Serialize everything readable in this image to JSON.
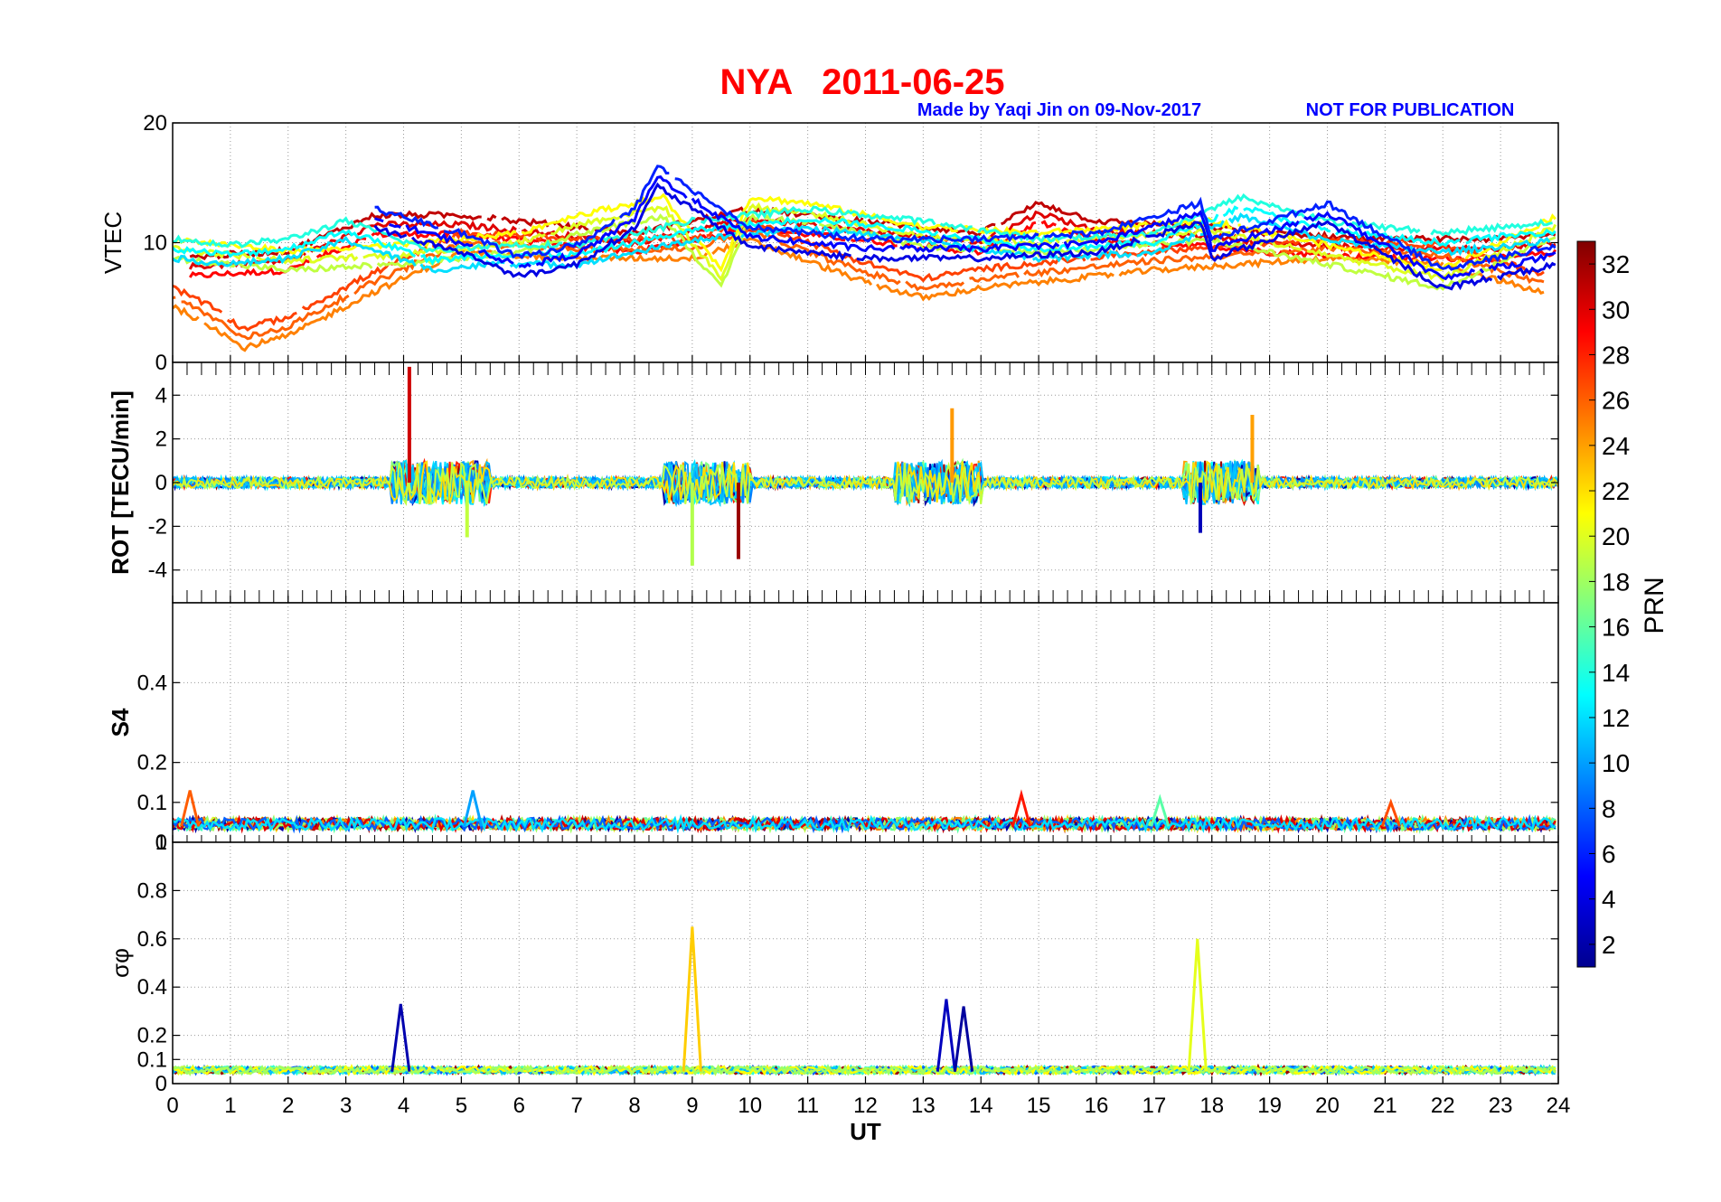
{
  "figure": {
    "title": "NYA   2011-06-25",
    "credit": "Made by Yaqi Jin on 09-Nov-2017",
    "notice": "NOT FOR PUBLICATION",
    "title_color": "#ff0000",
    "credit_color": "#0000ff"
  },
  "chart_data": [
    {
      "id": "vtec",
      "type": "line",
      "ylabel": "VTEC",
      "ylim": [
        0,
        20
      ],
      "yticks": [
        0,
        10,
        20
      ],
      "xlim": [
        0,
        24
      ],
      "grid": true,
      "series_summary": [
        {
          "prn_band": "high (29-32)",
          "x": [
            0.3,
            2,
            3.5,
            5,
            6,
            8,
            10,
            12,
            14,
            15,
            16,
            18,
            19,
            21,
            23,
            24
          ],
          "y": [
            8,
            8.5,
            11.5,
            11.5,
            11,
            10,
            12,
            11,
            10,
            12.5,
            11,
            10.5,
            10,
            9.5,
            9.5,
            10
          ]
        },
        {
          "prn_band": "mid-high (24-28)",
          "x": [
            0,
            0.8,
            1.2,
            2,
            3,
            3.4,
            5,
            7,
            9,
            10,
            12,
            13,
            14,
            17,
            20,
            22,
            23.8
          ],
          "y": [
            5.5,
            3.5,
            2,
            3,
            5.5,
            6.5,
            10,
            9.5,
            9.5,
            11,
            7.5,
            6.2,
            7,
            8.5,
            9.5,
            9,
            6.5
          ]
        },
        {
          "prn_band": "mid (17-23)",
          "x": [
            0,
            2,
            4,
            6,
            7,
            8.5,
            9.5,
            10,
            11,
            13,
            15,
            18,
            20,
            22,
            24
          ],
          "y": [
            9.5,
            8.5,
            9,
            10,
            11.5,
            13,
            7,
            13,
            12.5,
            10.5,
            10,
            11,
            9,
            7,
            11.5
          ]
        },
        {
          "prn_band": "low-mid (9-16)",
          "x": [
            0,
            1,
            2,
            3,
            4.5,
            5.5,
            7,
            8,
            9,
            11,
            13,
            15,
            17,
            18.5,
            20,
            22,
            24
          ],
          "y": [
            9.5,
            9,
            9.5,
            11,
            8.5,
            9,
            9,
            10,
            11,
            12,
            11,
            9.5,
            10,
            13,
            11,
            10,
            11
          ]
        },
        {
          "prn_band": "low (1-8)",
          "x": [
            3.5,
            5,
            6,
            7,
            8,
            8.4,
            9.2,
            10,
            12,
            14,
            16,
            17.8,
            18,
            20,
            22,
            24
          ],
          "y": [
            12,
            10,
            8,
            9,
            12,
            15.5,
            13,
            10.5,
            9.5,
            9.5,
            10,
            12.5,
            9.5,
            12.5,
            7,
            9
          ]
        }
      ]
    },
    {
      "id": "rot",
      "type": "line",
      "ylabel": "ROT [TECU/min]",
      "ylim": [
        -5.5,
        5.5
      ],
      "yticks": [
        -4,
        -2,
        0,
        2,
        4
      ],
      "xlim": [
        0,
        24
      ],
      "grid": true,
      "notable_spikes": [
        {
          "x": 4.1,
          "y": 5.3
        },
        {
          "x": 5.1,
          "y": -2.5
        },
        {
          "x": 9.0,
          "y": -3.8
        },
        {
          "x": 9.8,
          "y": -3.5
        },
        {
          "x": 13.5,
          "y": 3.4
        },
        {
          "x": 17.8,
          "y": -2.3
        },
        {
          "x": 18.7,
          "y": 3.1
        }
      ]
    },
    {
      "id": "s4",
      "type": "line",
      "ylabel": "S4",
      "ylim": [
        0,
        0.6
      ],
      "yticks": [
        0,
        0.1,
        0.2,
        0.4
      ],
      "xlim": [
        0,
        24
      ],
      "grid": true,
      "notable_peaks": [
        {
          "x": 0.3,
          "y": 0.13
        },
        {
          "x": 5.2,
          "y": 0.13
        },
        {
          "x": 14.7,
          "y": 0.12
        },
        {
          "x": 17.1,
          "y": 0.11
        },
        {
          "x": 21.1,
          "y": 0.1
        }
      ]
    },
    {
      "id": "sigma_phi",
      "type": "line",
      "ylabel": "σφ",
      "ylim": [
        0,
        1
      ],
      "yticks": [
        0,
        0.1,
        0.2,
        0.4,
        0.6,
        0.8,
        1
      ],
      "xlim": [
        0,
        24
      ],
      "xticks": [
        0,
        1,
        2,
        3,
        4,
        5,
        6,
        7,
        8,
        9,
        10,
        11,
        12,
        13,
        14,
        15,
        16,
        17,
        18,
        19,
        20,
        21,
        22,
        23,
        24
      ],
      "xlabel": "UT",
      "grid": true,
      "notable_peaks": [
        {
          "x": 3.95,
          "y": 0.33
        },
        {
          "x": 9.0,
          "y": 0.65
        },
        {
          "x": 13.4,
          "y": 0.35
        },
        {
          "x": 13.7,
          "y": 0.32
        },
        {
          "x": 17.75,
          "y": 0.6
        }
      ]
    }
  ],
  "colorbar": {
    "label": "PRN",
    "ticks": [
      2,
      4,
      6,
      8,
      10,
      12,
      14,
      16,
      18,
      20,
      22,
      24,
      26,
      28,
      30,
      32
    ],
    "range": [
      1,
      33
    ],
    "colormap": "jet",
    "stops": [
      "#00008f",
      "#0000ff",
      "#0080ff",
      "#00ffff",
      "#80ff80",
      "#ffff00",
      "#ff8000",
      "#ff0000",
      "#800000"
    ]
  }
}
